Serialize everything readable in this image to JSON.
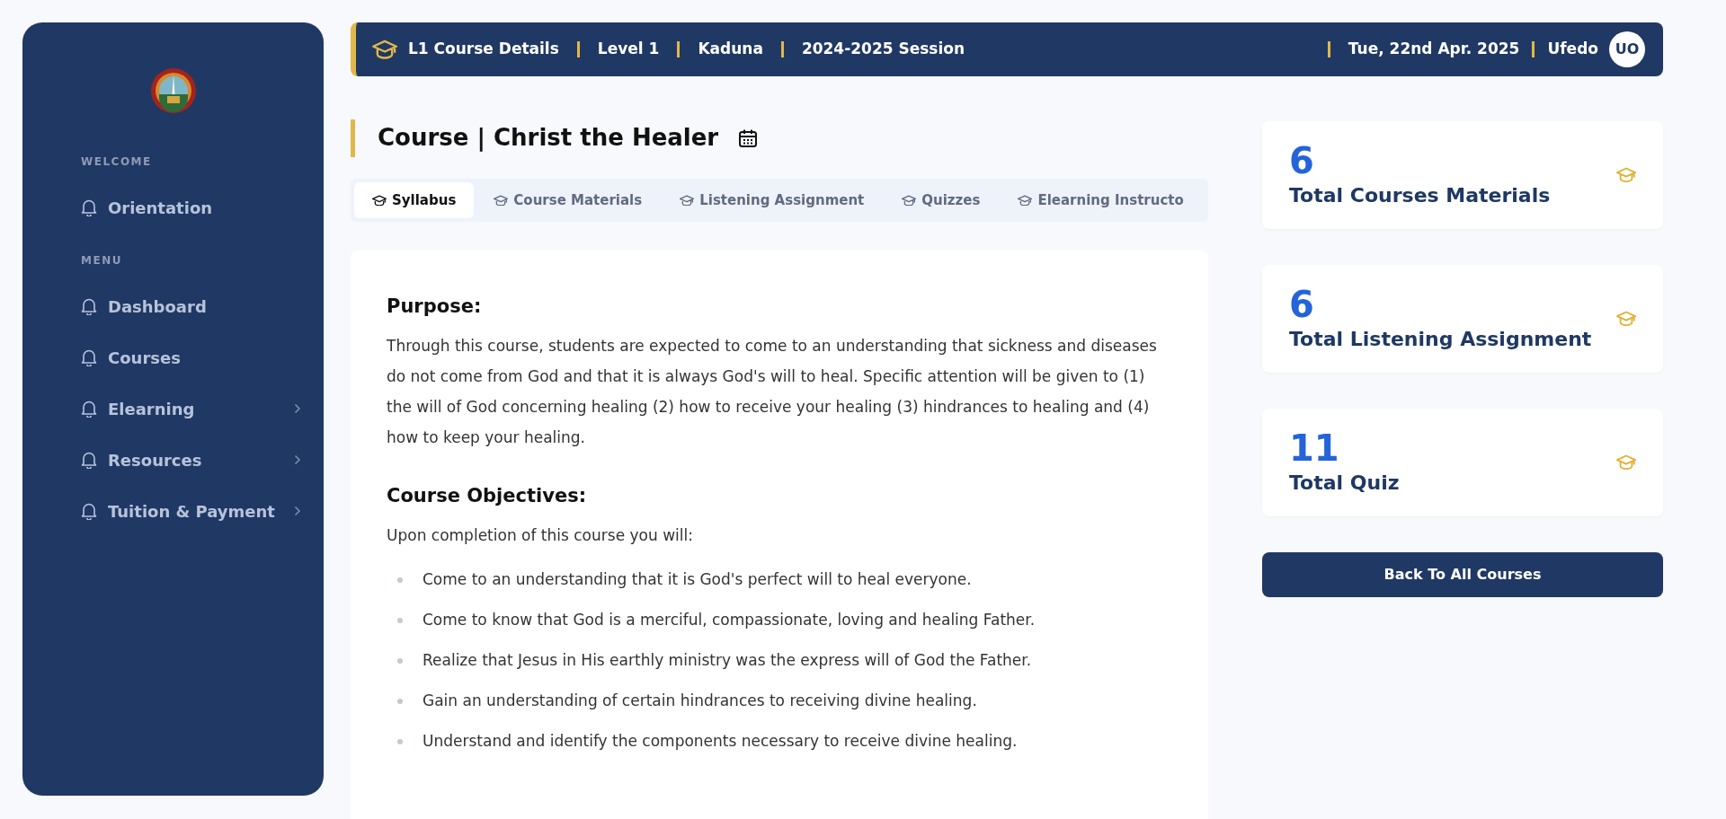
{
  "sidebar": {
    "sections": [
      {
        "heading": "WELCOME",
        "items": [
          {
            "label": "Orientation",
            "has_submenu": false
          }
        ]
      },
      {
        "heading": "MENU",
        "items": [
          {
            "label": "Dashboard",
            "has_submenu": false
          },
          {
            "label": "Courses",
            "has_submenu": false
          },
          {
            "label": "Elearning",
            "has_submenu": true
          },
          {
            "label": "Resources",
            "has_submenu": true
          },
          {
            "label": "Tuition & Payment",
            "has_submenu": true
          }
        ]
      }
    ]
  },
  "header": {
    "items": [
      "L1 Course Details",
      "Level 1",
      "Kaduna",
      "2024-2025 Session"
    ],
    "date": "Tue, 22nd Apr. 2025",
    "user": "Ufedo",
    "avatar": "UO"
  },
  "page_title": "Course | Christ the Healer",
  "tabs": [
    {
      "label": "Syllabus",
      "selected": true
    },
    {
      "label": "Course Materials",
      "selected": false
    },
    {
      "label": "Listening Assignment",
      "selected": false
    },
    {
      "label": "Quizzes",
      "selected": false
    },
    {
      "label": "Elearning Instructo",
      "selected": false
    }
  ],
  "syllabus": {
    "sections": [
      {
        "heading": "Purpose:",
        "paragraphs": [
          "Through this course, students are expected to come to an understanding that sickness and diseases do not come from God and that it is always God's will to heal. Specific attention will be given to (1) the will of God concerning healing (2) how to receive your healing (3) hindrances to healing and (4) how to keep your healing."
        ]
      },
      {
        "heading": "Course Objectives:",
        "paragraphs": [
          "Upon completion of this course you will:"
        ],
        "bullets": [
          "Come to an understanding that it is God's perfect will to heal everyone.",
          "Come to know that God is a merciful, compassionate, loving and healing Father.",
          "Realize that Jesus in His earthly ministry was the express will of God the Father.",
          "Gain an understanding of certain hindrances to receiving divine healing.",
          "Understand and identify the components necessary to receive divine healing."
        ]
      }
    ]
  },
  "stats": [
    {
      "value": "6",
      "label": "Total Courses Materials"
    },
    {
      "value": "6",
      "label": "Total Listening Assignment"
    },
    {
      "value": "11",
      "label": "Total Quiz"
    }
  ],
  "back_button": "Back To All Courses"
}
